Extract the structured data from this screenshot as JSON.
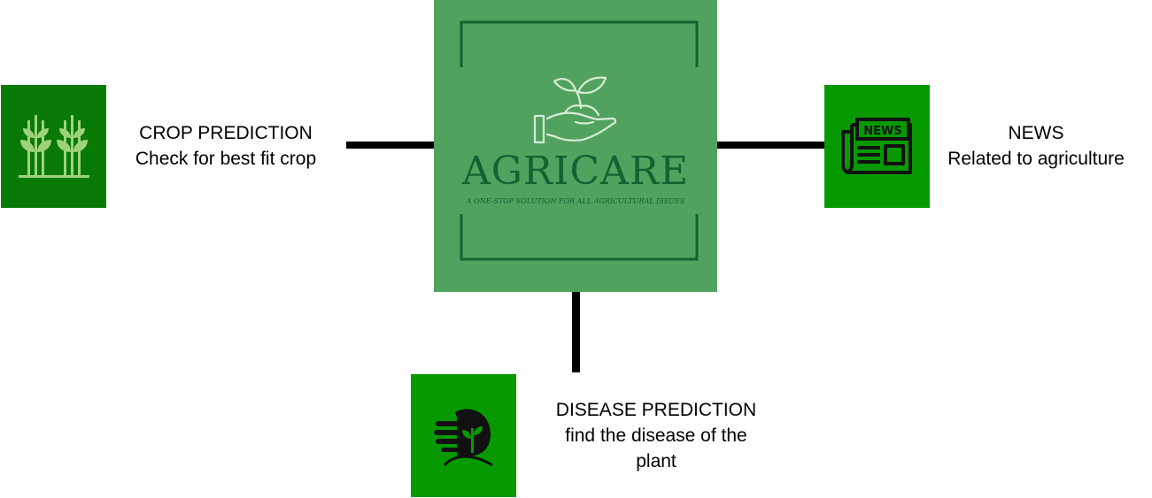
{
  "colors": {
    "logo_background": "#52a25f",
    "logo_ink": "#0f6431",
    "logo_sprout": "#d8ecd4",
    "tile_crop": "#097a06",
    "tile_green": "#069a00",
    "connector": "#000000",
    "crop_icon": "#9fd27c",
    "icon_dark": "#111111"
  },
  "logo": {
    "name": "AGRICARE",
    "tagline": "A ONE-STOP SOLUTION FOR ALL AGRICULTURAL ISSUES",
    "icon": "sprout-in-hand-icon"
  },
  "features": {
    "crop": {
      "title": "CROP PREDICTION",
      "subtitle": "Check for best fit crop",
      "icon": "crop-plants-icon"
    },
    "news": {
      "title": "NEWS",
      "subtitle": "Related to agriculture",
      "icon": "newspaper-icon"
    },
    "disease": {
      "title": "DISEASE PREDICTION",
      "subtitle_line1": "find the disease of the",
      "subtitle_line2": "plant",
      "icon": "hand-plant-icon"
    }
  }
}
